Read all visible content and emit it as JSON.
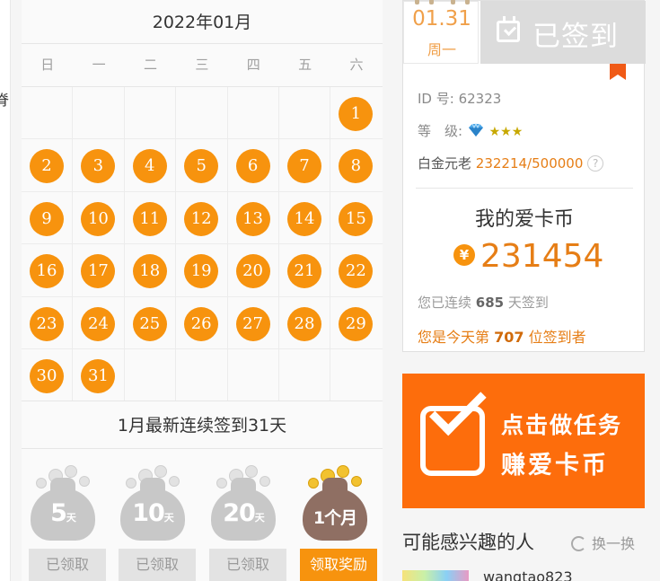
{
  "left_strip": {
    "cut_glyph": "脊"
  },
  "calendar": {
    "title": "2022年01月",
    "weekdays": [
      "日",
      "一",
      "二",
      "三",
      "四",
      "五",
      "六"
    ],
    "first_weekday_index": 6,
    "days_in_month": 31,
    "checked_days": [
      1,
      2,
      3,
      4,
      5,
      6,
      7,
      8,
      9,
      10,
      11,
      12,
      13,
      14,
      15,
      16,
      17,
      18,
      19,
      20,
      21,
      22,
      23,
      24,
      25,
      26,
      27,
      28,
      29,
      30,
      31
    ],
    "streak_text": "1月最新连续签到31天",
    "rewards": [
      {
        "label": "5",
        "unit": "天",
        "state": "claimed",
        "button": "已领取",
        "color": "#c8c8c8"
      },
      {
        "label": "10",
        "unit": "天",
        "state": "claimed",
        "button": "已领取",
        "color": "#c8c8c8"
      },
      {
        "label": "20",
        "unit": "天",
        "state": "claimed",
        "button": "已领取",
        "color": "#c8c8c8"
      },
      {
        "label": "1个月",
        "unit": "",
        "state": "available",
        "button": "领取奖励",
        "color": "#8f6f63"
      }
    ]
  },
  "user_card": {
    "date": "01.31",
    "weekday": "周一",
    "signed_label": "已签到",
    "id_label": "ID 号:",
    "id_value": "62323",
    "level_label": "等　级:",
    "level_stars": "★★★",
    "title_label": "白金元老",
    "title_progress": "232214/500000",
    "help_icon": "?",
    "coin_title": "我的爱卡币",
    "coin_symbol": "¥",
    "coin_value": "231454",
    "streak_prefix": "您已连续",
    "streak_days": "685",
    "streak_suffix": "天签到",
    "rank_prefix": "您是今天第",
    "rank_value": "707",
    "rank_suffix": "位签到者"
  },
  "banner": {
    "line1": "点击做任务",
    "line2": "赚爱卡币",
    "color": "#fd6d0c"
  },
  "interests": {
    "title": "可能感兴趣的人",
    "refresh_label": "换一换",
    "first_user": "wangtao823"
  },
  "colors": {
    "accent": "#f7930e",
    "value": "#e67e16"
  }
}
